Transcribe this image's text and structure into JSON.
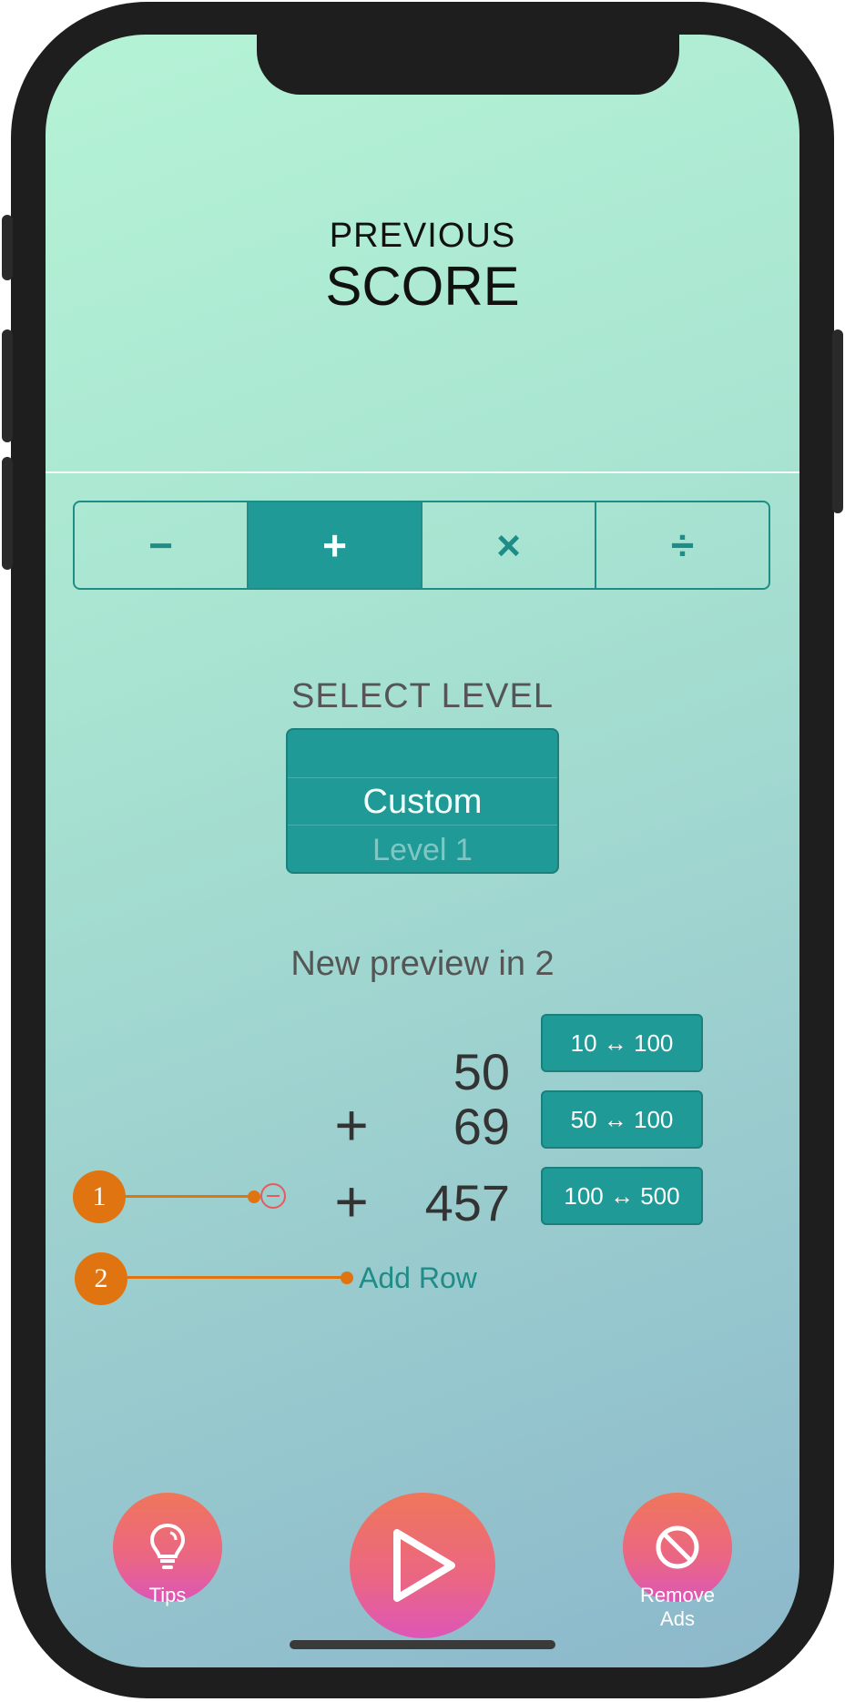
{
  "header": {
    "previous_label": "PREVIOUS",
    "score_label": "SCORE"
  },
  "operations": {
    "items": [
      {
        "label": "−",
        "name": "subtract"
      },
      {
        "label": "+",
        "name": "add"
      },
      {
        "label": "×",
        "name": "multiply"
      },
      {
        "label": "÷",
        "name": "divide"
      }
    ],
    "selected": "+"
  },
  "level": {
    "title": "SELECT LEVEL",
    "options": [
      "Custom",
      "Level 1"
    ],
    "selected": "Custom"
  },
  "preview": {
    "label": "New preview in 2",
    "rows": [
      {
        "operator": "",
        "value": "50",
        "range": "10 ↔ 100"
      },
      {
        "operator": "+",
        "value": "69",
        "range": "50 ↔ 100"
      },
      {
        "operator": "+",
        "value": "457",
        "range": "100 ↔ 500"
      }
    ],
    "add_row_label": "Add Row"
  },
  "callouts": [
    "1",
    "2"
  ],
  "bottom_bar": {
    "tips_label": "Tips",
    "remove_ads_label": "Remove\nAds"
  },
  "colors": {
    "accent": "#1f9a96",
    "callout": "#e07410",
    "delete": "#e85a5a"
  },
  "icons": [
    "lightbulb-icon",
    "play-icon",
    "no-ads-icon",
    "minus-circle-icon"
  ]
}
